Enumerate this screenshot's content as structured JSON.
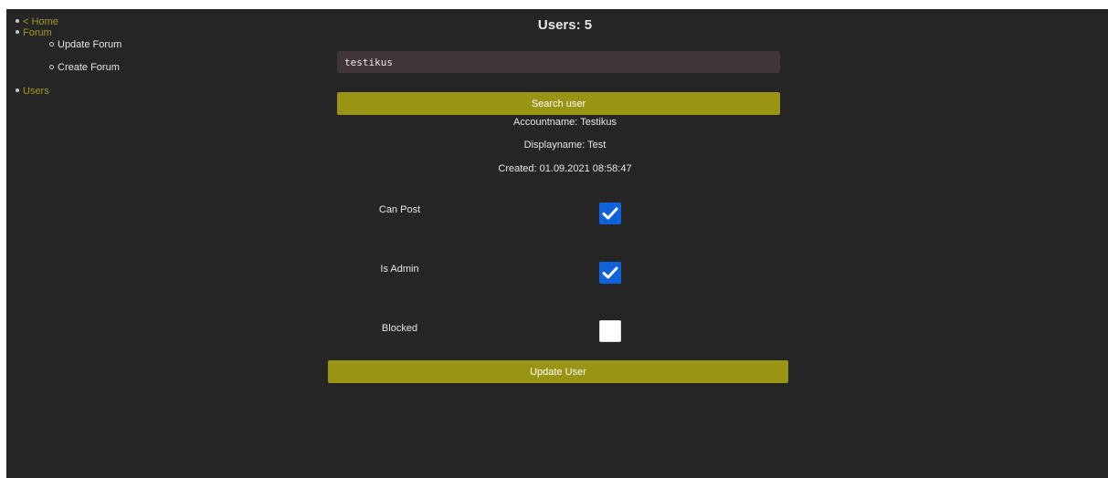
{
  "sidebar": {
    "items": [
      {
        "label": "< Home",
        "level": 1
      },
      {
        "label": "Forum",
        "level": 1
      },
      {
        "label": "Update Forum",
        "level": 2
      },
      {
        "label": "Create Forum",
        "level": 2
      },
      {
        "label": "Users",
        "level": 1
      }
    ]
  },
  "main": {
    "title": "Users: 5",
    "search": {
      "value": "testikus"
    },
    "search_button": "Search user",
    "user": {
      "account_name": "Accountname: Testikus",
      "display_name": "Displayname: Test",
      "created": "Created: 01.09.2021 08:58:47"
    },
    "permissions": [
      {
        "label": "Can Post",
        "checked": true
      },
      {
        "label": "Is Admin",
        "checked": true
      },
      {
        "label": "Blocked",
        "checked": false
      }
    ],
    "update_button": "Update User"
  },
  "colors": {
    "background": "#252525",
    "accent": "#9a9414",
    "link": "#a29c19",
    "input_background": "#403639",
    "checkbox_checked": "#0f62d8"
  }
}
